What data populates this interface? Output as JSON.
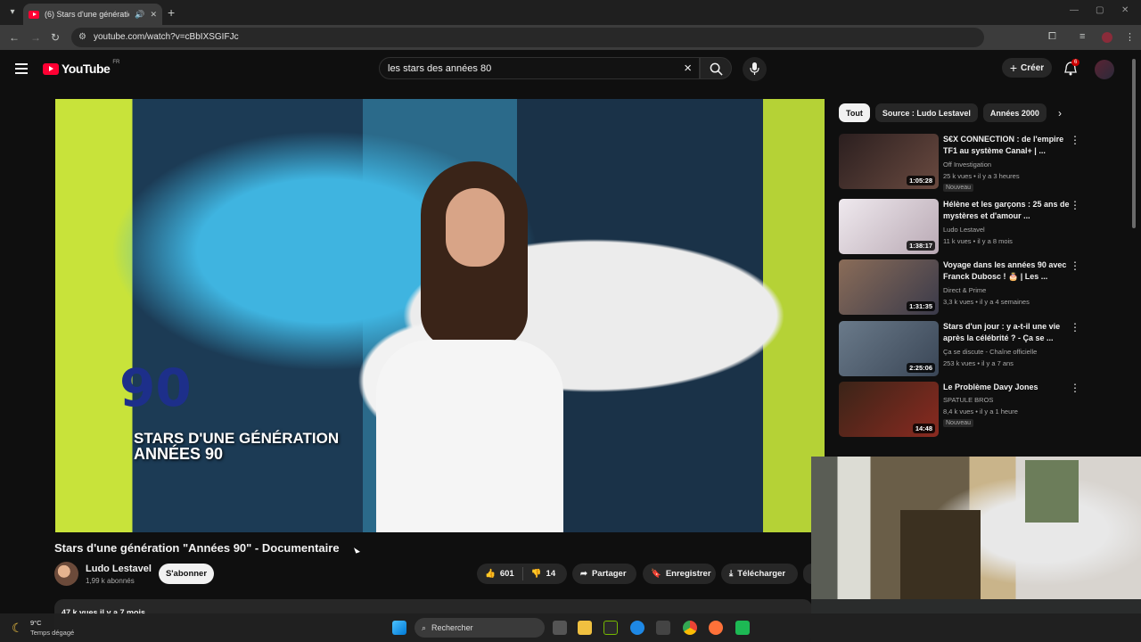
{
  "browser": {
    "tab_title": "(6) Stars d'une génération \"",
    "url": "youtube.com/watch?v=cBbIXSGIFJc"
  },
  "header": {
    "logo_text": "YouTube",
    "region": "FR",
    "search_value": "les stars des années 80",
    "create_label": "Créer",
    "notification_count": "6"
  },
  "video": {
    "overlay_line1": "STARS D'UNE GÉNÉRATION",
    "overlay_line2": "ANNÉES 90",
    "title": "Stars d'une génération \"Années 90\" - Documentaire",
    "channel": "Ludo Lestavel",
    "subscribers": "1,99 k abonnés",
    "subscribe_label": "S'abonner",
    "likes": "601",
    "dislikes": "14",
    "share_label": "Partager",
    "save_label": "Enregistrer",
    "download_label": "Télécharger",
    "meta": "47 k vues  il y a 7 mois"
  },
  "chips": [
    "Tout",
    "Source : Ludo Lestavel",
    "Années 2000"
  ],
  "recommendations": [
    {
      "title": "S€X CONNECTION : de l'empire TF1 au système Canal+ | ...",
      "channel": "Off Investigation",
      "meta": "25 k vues • il y a 3 heures",
      "duration": "1:05:28",
      "badge": "Nouveau",
      "thumb_color": "#3a2a2a"
    },
    {
      "title": "Hélène et les garçons : 25 ans de mystères et d'amour ...",
      "channel": "Ludo Lestavel",
      "meta": "11 k vues • il y a 8 mois",
      "duration": "1:38:17",
      "badge": "",
      "thumb_color": "#d9d4d8"
    },
    {
      "title": "Voyage dans les années 90 avec Franck Dubosc ! 🎂 | Les ...",
      "channel": "Direct & Prime",
      "meta": "3,3 k vues • il y a 4 semaines",
      "duration": "1:31:35",
      "badge": "",
      "thumb_color": "#6c5b50"
    },
    {
      "title": "Stars d'un jour : y a-t-il une vie après la célébrité ? - Ça se ...",
      "channel": "Ça se discute - Chaîne officielle",
      "meta": "253 k vues • il y a 7 ans",
      "duration": "2:25:06",
      "badge": "",
      "thumb_color": "#4a5a6a"
    },
    {
      "title": "Le Problème Davy Jones",
      "channel": "SPATULE BROS",
      "meta": "8,4 k vues • il y a 1 heure",
      "duration": "14:48",
      "badge": "Nouveau",
      "thumb_color": "#3a2a20"
    }
  ],
  "taskbar": {
    "temperature": "9°C",
    "weather": "Temps dégagé",
    "search_label": "Rechercher"
  }
}
